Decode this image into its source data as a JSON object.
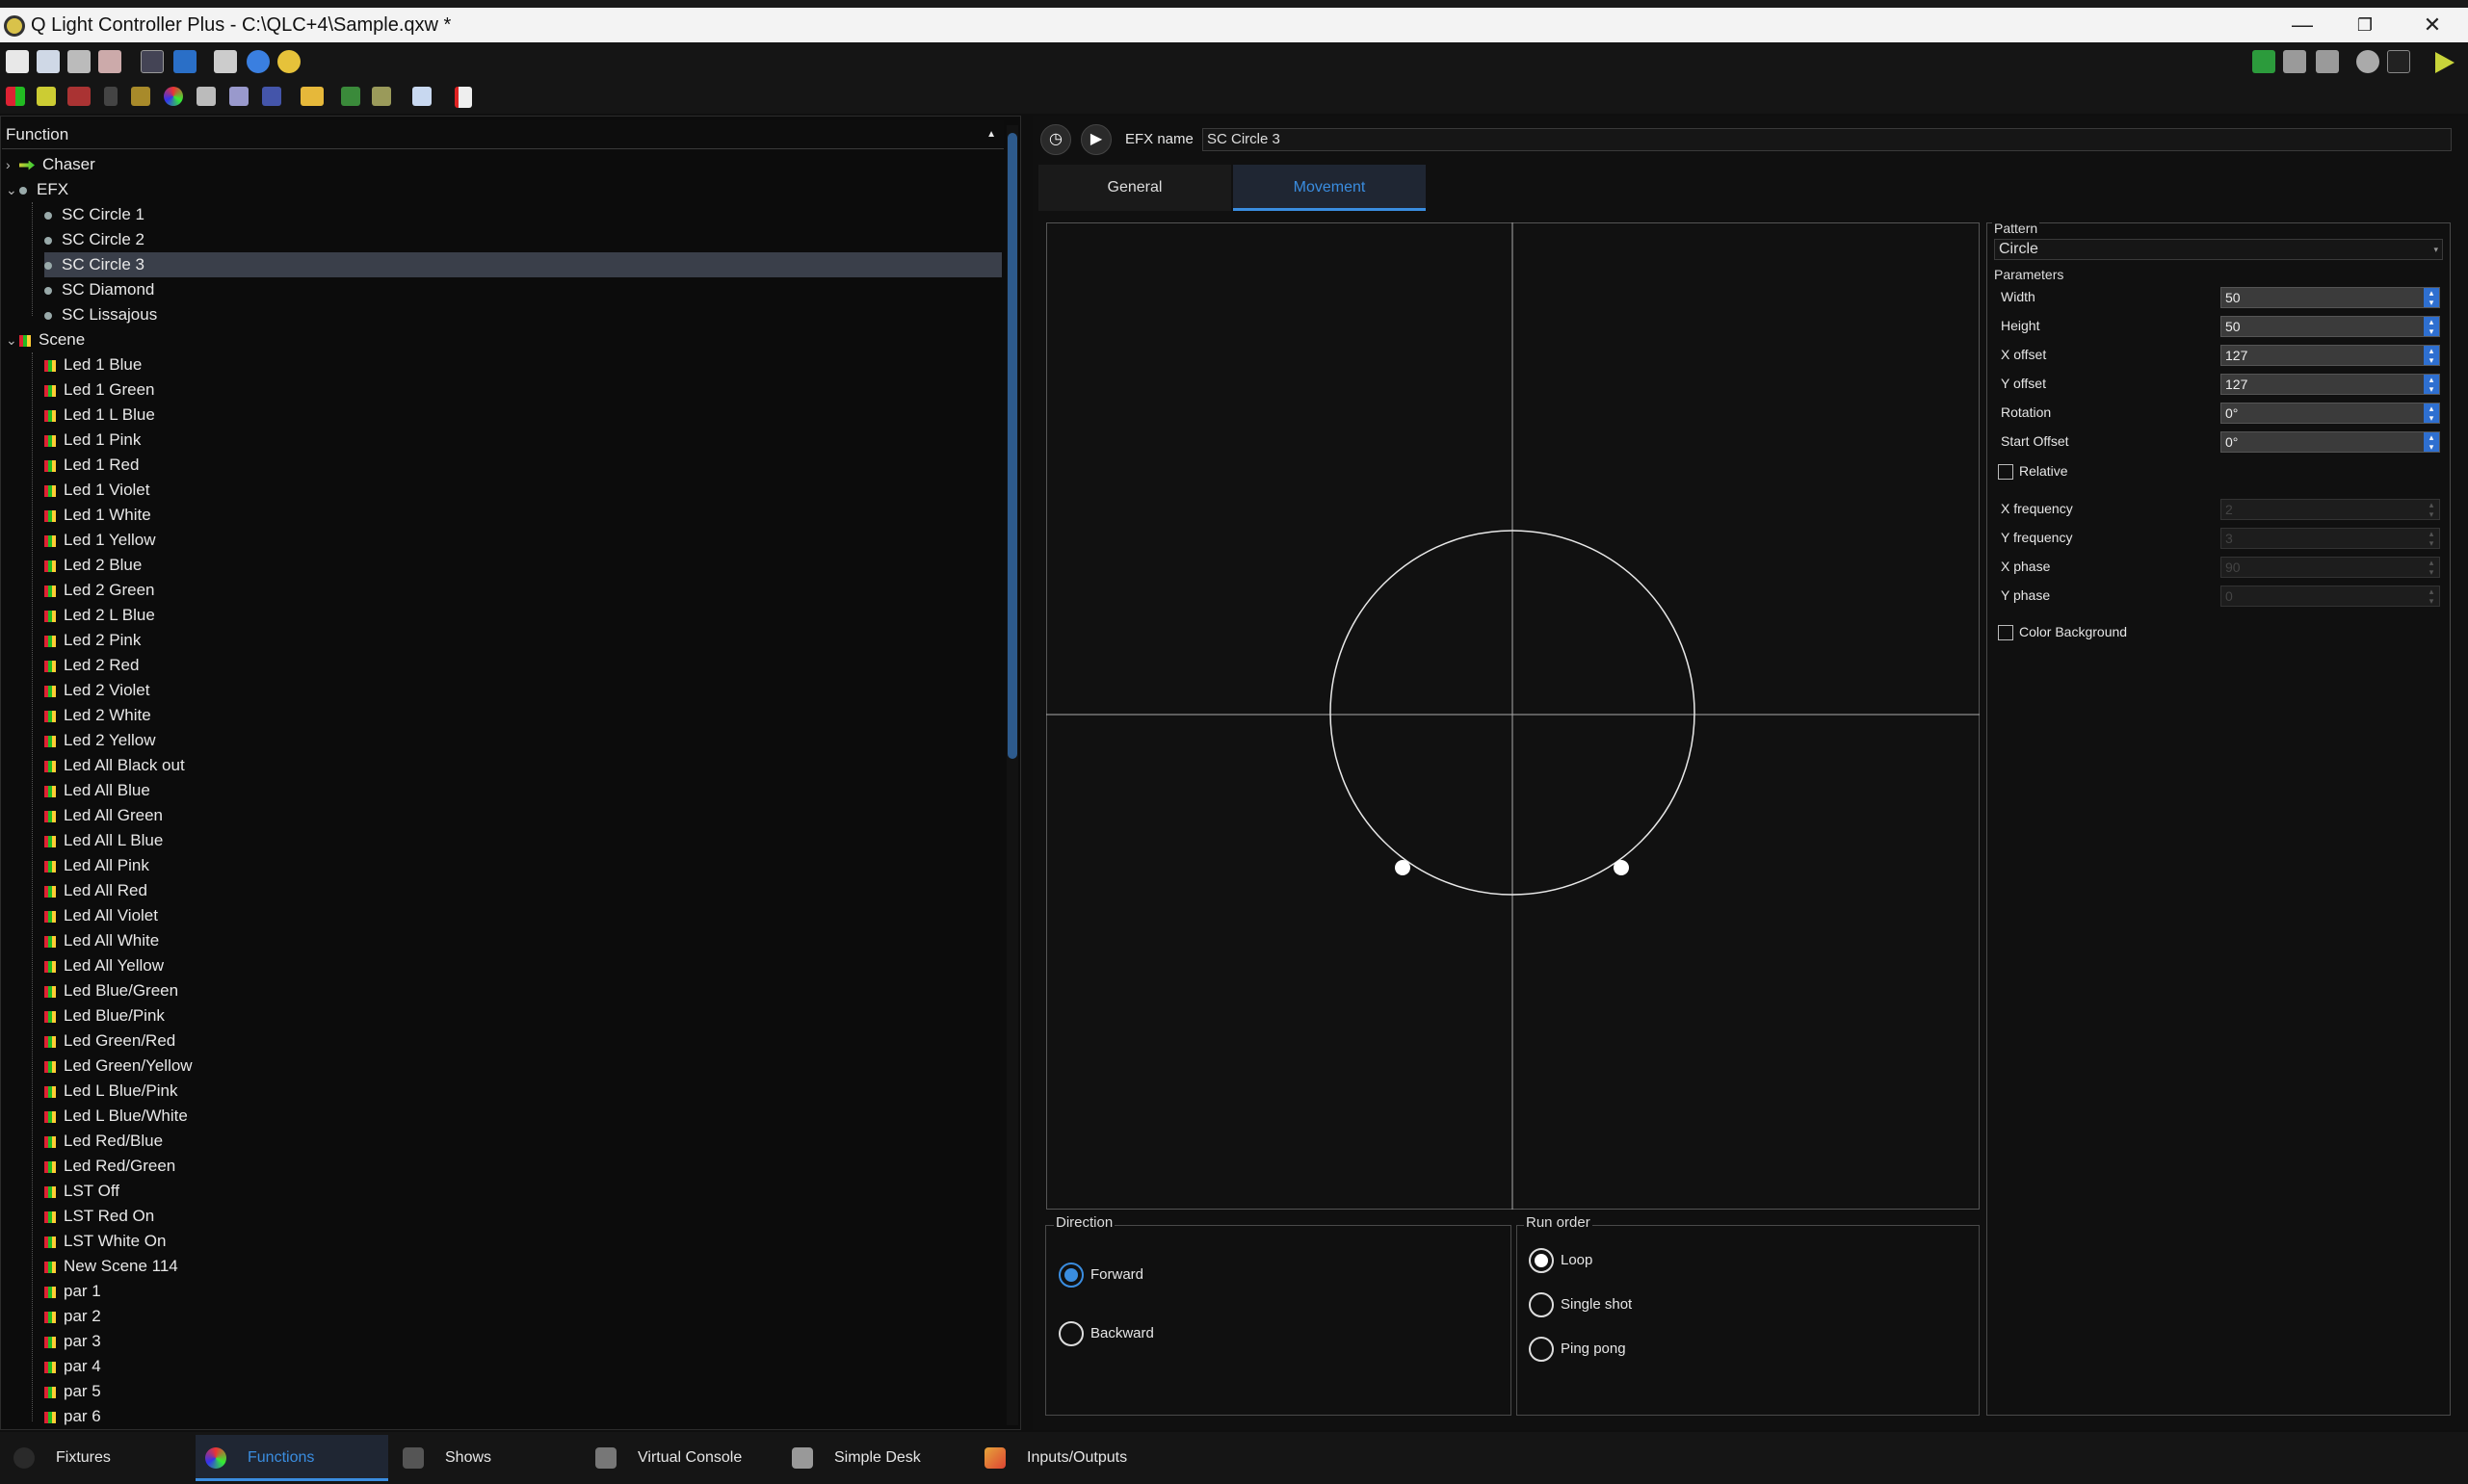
{
  "window": {
    "title": "Q Light Controller Plus - C:\\QLC+4\\Sample.qxw *",
    "minimize": "—",
    "restore": "❐",
    "close": "✕"
  },
  "function_tree": {
    "header": "Function",
    "sort_arrow": "▲",
    "categories": {
      "chaser": "Chaser",
      "efx": "EFX",
      "scene": "Scene"
    },
    "efx_items": [
      "SC Circle 1",
      "SC Circle 2",
      "SC Circle 3",
      "SC Diamond",
      "SC Lissajous"
    ],
    "scene_items": [
      "Led 1 Blue",
      "Led 1 Green",
      "Led 1 L Blue",
      "Led 1 Pink",
      "Led 1 Red",
      "Led 1 Violet",
      "Led 1 White",
      "Led 1 Yellow",
      "Led 2 Blue",
      "Led 2 Green",
      "Led 2 L Blue",
      "Led 2 Pink",
      "Led 2 Red",
      "Led 2 Violet",
      "Led 2 White",
      "Led 2 Yellow",
      "Led All Black out",
      "Led All Blue",
      "Led All Green",
      "Led All L Blue",
      "Led All Pink",
      "Led All Red",
      "Led All Violet",
      "Led All White",
      "Led All Yellow",
      "Led Blue/Green",
      "Led Blue/Pink",
      "Led Green/Red",
      "Led Green/Yellow",
      "Led L Blue/Pink",
      "Led L Blue/White",
      "Led Red/Blue",
      "Led Red/Green",
      "LST Off",
      "LST Red On",
      "LST White On",
      "New Scene 114",
      "par 1",
      "par 2",
      "par 3",
      "par 4",
      "par 5",
      "par 6"
    ],
    "selected": "SC Circle 3"
  },
  "efx_editor": {
    "name_label": "EFX name",
    "name_value": "SC Circle 3",
    "tabs": [
      "General",
      "Movement"
    ],
    "active_tab": "Movement",
    "pattern": {
      "title": "Pattern",
      "value": "Circle"
    },
    "parameters": {
      "title": "Parameters",
      "rows": [
        {
          "label": "Width",
          "value": "50"
        },
        {
          "label": "Height",
          "value": "50"
        },
        {
          "label": "X offset",
          "value": "127"
        },
        {
          "label": "Y offset",
          "value": "127"
        },
        {
          "label": "Rotation",
          "value": "0°"
        },
        {
          "label": "Start Offset",
          "value": "0°"
        }
      ],
      "relative_label": "Relative",
      "freq_rows": [
        {
          "label": "X frequency",
          "value": "2"
        },
        {
          "label": "Y frequency",
          "value": "3"
        },
        {
          "label": "X phase",
          "value": "90"
        },
        {
          "label": "Y phase",
          "value": "0"
        }
      ],
      "color_background_label": "Color Background"
    },
    "direction": {
      "title": "Direction",
      "forward": "Forward",
      "backward": "Backward",
      "selected": "Forward"
    },
    "run_order": {
      "title": "Run order",
      "loop": "Loop",
      "single_shot": "Single shot",
      "ping_pong": "Ping pong",
      "selected": "Loop"
    }
  },
  "bottom_tabs": [
    "Fixtures",
    "Functions",
    "Shows",
    "Virtual Console",
    "Simple Desk",
    "Inputs/Outputs"
  ],
  "active_bottom_tab": "Functions",
  "colors": {
    "accent": "#3a8de0",
    "selection": "#3a3f4a",
    "background": "#0f0f0f"
  }
}
